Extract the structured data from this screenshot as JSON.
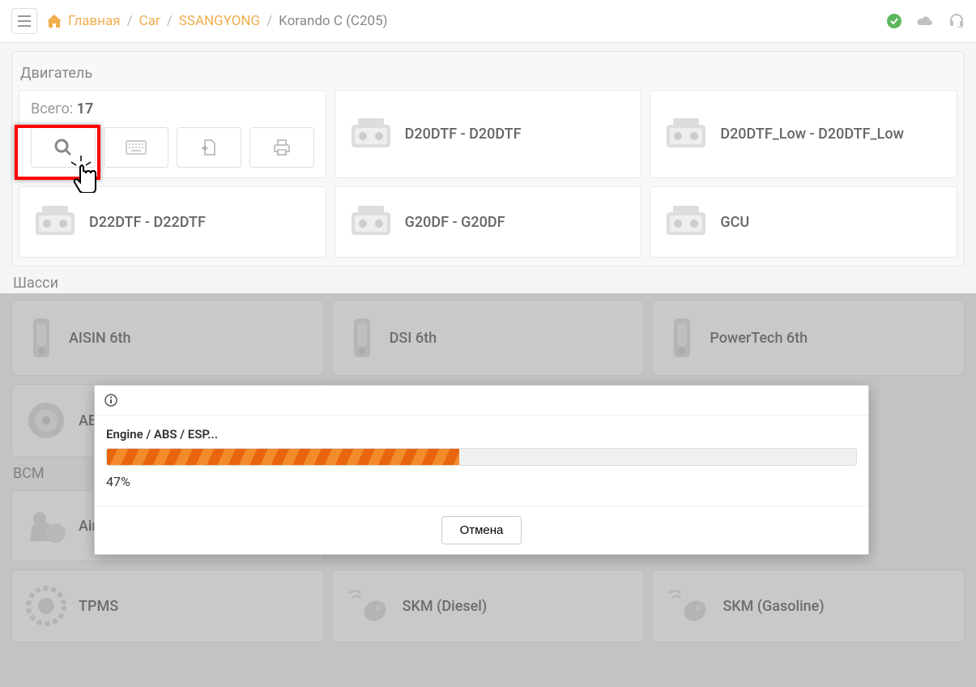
{
  "breadcrumb": {
    "home": "Главная",
    "car": "Car",
    "brand": "SSANGYONG",
    "model": "Korando C (C205)"
  },
  "sections": {
    "engine_title": "Двигатель",
    "chassis_title": "Шасси",
    "bcm_title": "BCM",
    "total_label": "Всего: ",
    "total_value": "17"
  },
  "engine_cards": [
    "D20DTF - D20DTF",
    "D20DTF_Low - D20DTF_Low",
    "D22DTF - D22DTF",
    "G20DF - G20DF",
    "GCU"
  ],
  "chassis_cards": [
    "AISIN 6th",
    "DSI 6th",
    "PowerTech 6th",
    "ABS / ESP"
  ],
  "bcm_cards": [
    "Airbag",
    "TPMS",
    "SKM (Diesel)",
    "SKM (Gasoline)"
  ],
  "modal": {
    "title": "Engine / ABS / ESP...",
    "percent_text": "47%",
    "percent_value": 47,
    "cancel": "Отмена"
  }
}
